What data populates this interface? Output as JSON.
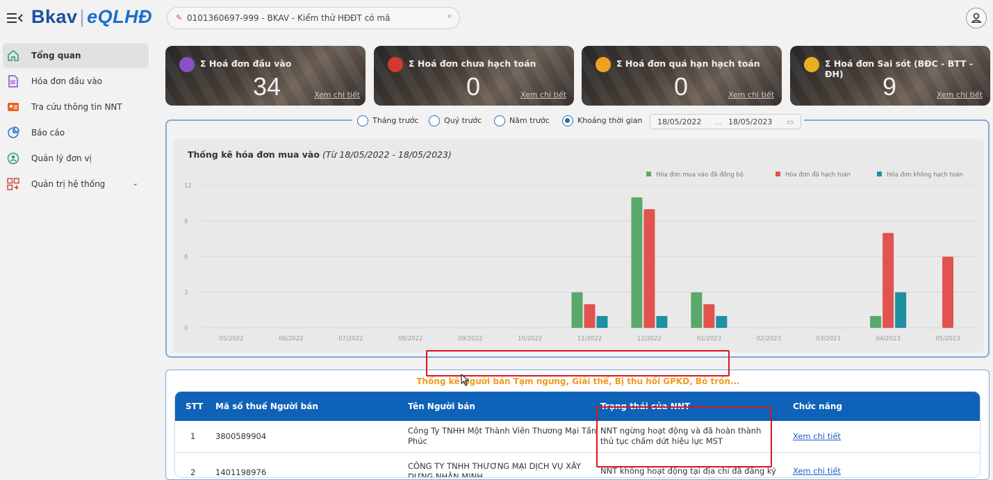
{
  "app": {
    "logo_part1": "Bkav",
    "logo_part2": "eQLHĐ",
    "company": "0101360697-999 - BKAV - Kiểm thử HĐĐT có mã"
  },
  "sidebar": {
    "items": [
      {
        "label": "Tổng quan",
        "icon": "home-icon"
      },
      {
        "label": "Hóa đơn đầu vào",
        "icon": "document-icon"
      },
      {
        "label": "Tra cứu thông tin NNT",
        "icon": "id-card-icon"
      },
      {
        "label": "Báo cáo",
        "icon": "chart-pie-icon"
      },
      {
        "label": "Quản lý đơn vị",
        "icon": "unit-icon"
      },
      {
        "label": "Quản trị hệ thống",
        "icon": "grid-icon"
      }
    ]
  },
  "cards": [
    {
      "title": "Σ Hoá đơn đầu vào",
      "value": "34",
      "link": "Xem chi tiết",
      "badge_color": "#8a4fc9"
    },
    {
      "title": "Σ Hoá đơn chưa hạch toán",
      "value": "0",
      "link": "Xem chi tiết",
      "badge_color": "#d23a2f"
    },
    {
      "title": "Σ Hoá đơn quá hạn hạch toán",
      "value": "0",
      "link": "Xem chi tiết",
      "badge_color": "#f0a020"
    },
    {
      "title": "Σ Hoá đơn Sai sót (BĐC - BTT - ĐH)",
      "value": "9",
      "link": "Xem chi tiết",
      "badge_color": "#e8b020"
    }
  ],
  "filters": {
    "options": [
      "Tháng trước",
      "Quý trước",
      "Năm trước",
      "Khoảng thời gian"
    ],
    "selected": "Khoảng thời gian",
    "date_from": "18/05/2022",
    "date_sep": "...",
    "date_to": "18/05/2023"
  },
  "chart_data": {
    "type": "bar",
    "title": "Thống kê hóa đơn mua vào",
    "subtitle": "(Từ 18/05/2022 - 18/05/2023)",
    "categories": [
      "05/2022",
      "06/2022",
      "07/2022",
      "08/2022",
      "09/2022",
      "10/2022",
      "11/2022",
      "12/2022",
      "01/2023",
      "02/2023",
      "03/2023",
      "04/2023",
      "05/2023"
    ],
    "series": [
      {
        "name": "Hóa đơn mua vào đã đồng bộ",
        "color": "#5aa86a",
        "values": [
          0,
          0,
          0,
          0,
          0,
          0,
          3,
          11,
          3,
          0,
          0,
          1,
          0
        ]
      },
      {
        "name": "Hóa đơn đã hạch toán",
        "color": "#e0534f",
        "values": [
          0,
          0,
          0,
          0,
          0,
          0,
          2,
          10,
          2,
          0,
          0,
          8,
          6
        ]
      },
      {
        "name": "Hóa đơn không hạch toán",
        "color": "#1f8fa3",
        "values": [
          0,
          0,
          0,
          0,
          0,
          0,
          1,
          1,
          1,
          0,
          0,
          3,
          0
        ]
      }
    ],
    "ylim": [
      0,
      12
    ],
    "yticks": [
      "0",
      "3",
      "6",
      "9",
      "12"
    ],
    "grid": true,
    "legend": "top-right"
  },
  "seller_table": {
    "title": "Thống kê Người bán Tạm ngưng, Giải thể, Bị thu hồi GPKD, Bỏ trốn...",
    "headers": [
      "STT",
      "Mã số thuế Người bán",
      "Tên Người bán",
      "Trạng thái của NNT",
      "Chức năng"
    ],
    "rows": [
      {
        "stt": "1",
        "mst": "3800589904",
        "name": "Công Ty TNHH Một Thành Viên Thương Mại Tấn Phúc",
        "status": "NNT ngừng hoạt động và đã hoàn thành thủ tục chấm dứt hiệu lực MST",
        "action": "Xem chi tiết"
      },
      {
        "stt": "2",
        "mst": "1401198976",
        "name": "CÔNG TY TNHH THƯƠNG MẠI DỊCH VỤ XÂY DỰNG NHÂN MINH",
        "status": "NNT không hoạt động tại địa chỉ đã đăng ký",
        "action": "Xem chi tiết"
      }
    ]
  }
}
